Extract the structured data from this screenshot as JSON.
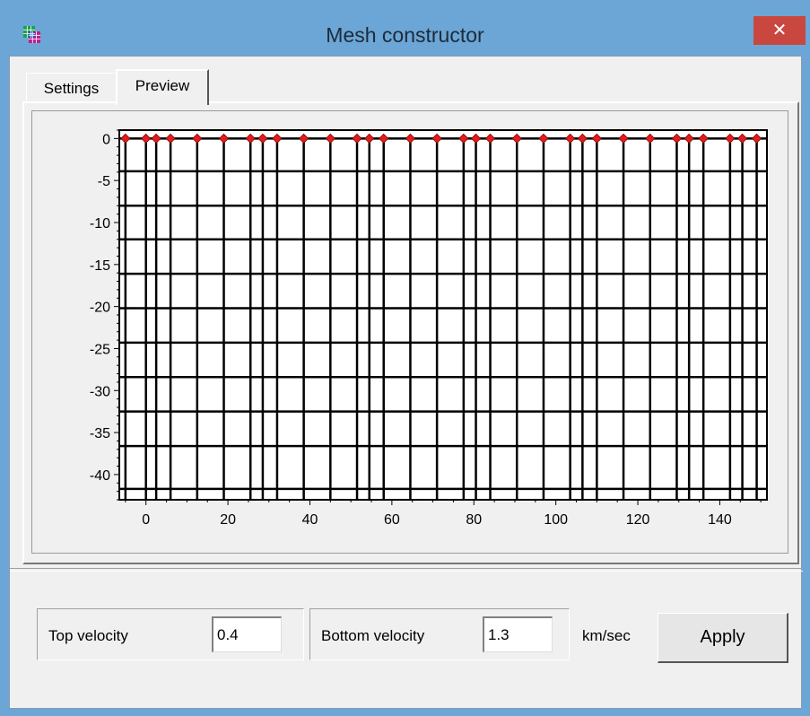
{
  "window": {
    "title": "Mesh constructor",
    "close_glyph": "✕",
    "app_icon": "grid-app-icon"
  },
  "tabs": [
    {
      "label": "Settings",
      "active": false
    },
    {
      "label": "Preview",
      "active": true
    }
  ],
  "chart_data": {
    "type": "mesh-grid",
    "title": "",
    "xlabel": "",
    "ylabel": "",
    "xlim": [
      -6.5,
      151.5
    ],
    "ylim": [
      -43,
      1
    ],
    "x_ticks": [
      0,
      20,
      40,
      60,
      80,
      100,
      120,
      140
    ],
    "y_ticks": [
      0,
      -5,
      -10,
      -15,
      -20,
      -25,
      -30,
      -35,
      -40
    ],
    "vertical_lines_x": [
      -5,
      0,
      2.5,
      6,
      12.5,
      19,
      25.5,
      28.5,
      32,
      38.5,
      45,
      51.5,
      54.5,
      58,
      64.5,
      71,
      77.5,
      80.5,
      84,
      90.5,
      97,
      103.5,
      106.5,
      110,
      116.5,
      123,
      129.5,
      132.5,
      136,
      142.5,
      145.5,
      149
    ],
    "horizontal_lines_y": [
      0,
      -3.9,
      -8,
      -12,
      -16.1,
      -20.2,
      -24.3,
      -28.4,
      -32.5,
      -36.6,
      -41.7
    ],
    "stations_x": [
      -5,
      0,
      2.5,
      6,
      12.5,
      19,
      25.5,
      28.5,
      32,
      38.5,
      45,
      51.5,
      54.5,
      58,
      64.5,
      71,
      77.5,
      80.5,
      84,
      90.5,
      97,
      103.5,
      106.5,
      110,
      116.5,
      123,
      129.5,
      132.5,
      136,
      142.5,
      145.5,
      149
    ],
    "station_y": 0,
    "colors": {
      "grid": "#000000",
      "station": "#e41c1c",
      "background": "#ffffff"
    }
  },
  "velocity": {
    "top_label": "Top velocity",
    "top_value": "0.4",
    "bottom_label": "Bottom velocity",
    "bottom_value": "1.3",
    "units": "km/sec"
  },
  "apply_label": "Apply"
}
